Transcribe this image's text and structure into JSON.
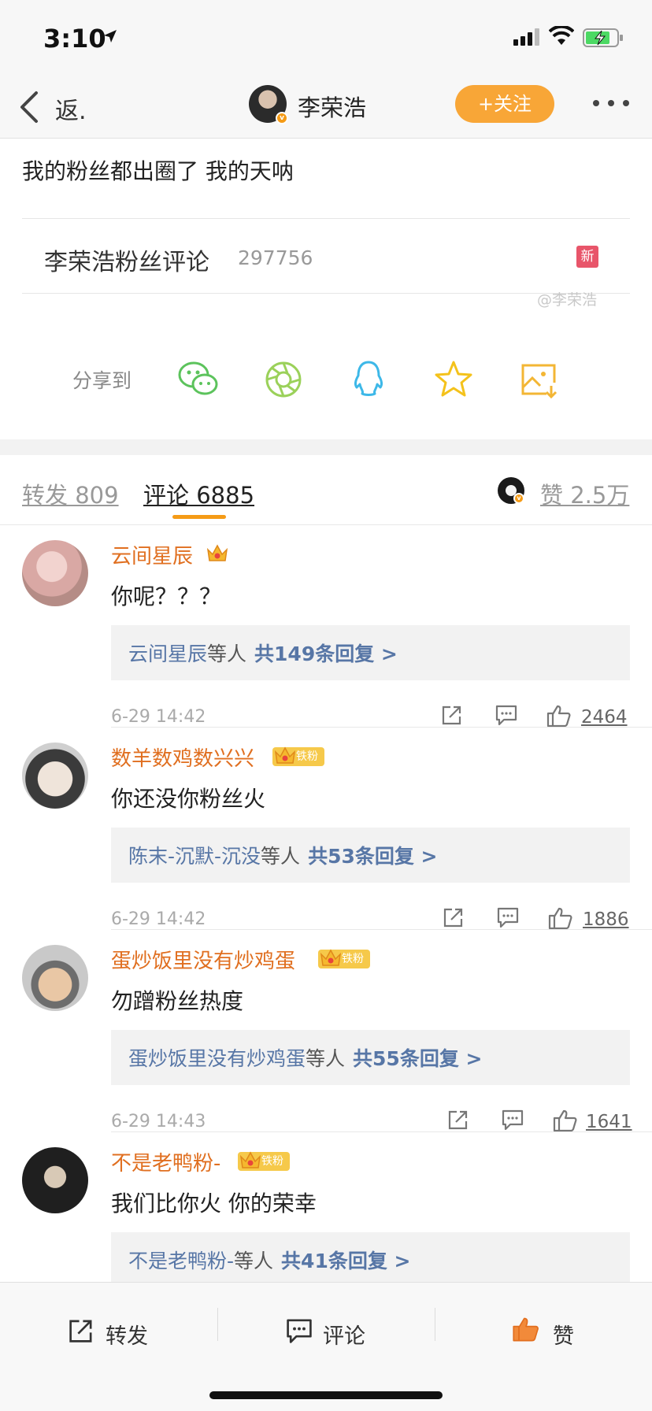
{
  "status_bar": {
    "time": "3:10"
  },
  "nav": {
    "back_label": "返.",
    "account_name": "李荣浩",
    "follow_label": "+关注"
  },
  "post": {
    "text": "我的粉丝都出圈了 我的天呐",
    "topic_title": "李荣浩粉丝评论",
    "topic_count": "297756",
    "new_badge": "新",
    "watermark": "@李荣浩"
  },
  "share": {
    "label": "分享到",
    "icons": [
      "wechat-icon",
      "moments-icon",
      "qq-icon",
      "favorite-star-icon",
      "save-image-icon"
    ]
  },
  "tabs": {
    "repost": "转发 809",
    "comment": "评论 6885",
    "like": "赞 2.5万"
  },
  "comments": [
    {
      "name": "云间星辰",
      "iron_label": "",
      "text": "你呢？？？",
      "reply_users": "云间星辰",
      "reply_etc": "等人",
      "reply_count": "共149条回复 >",
      "time": "6-29 14:42",
      "likes": "2464"
    },
    {
      "name": "数羊数鸡数兴兴",
      "iron_label": "铁粉",
      "text": "你还没你粉丝火",
      "reply_users": "陈末-沉默-沉没",
      "reply_etc": "等人",
      "reply_count": "共53条回复 >",
      "time": "6-29 14:42",
      "likes": "1886"
    },
    {
      "name": "蛋炒饭里没有炒鸡蛋",
      "iron_label": "铁粉",
      "text": "勿蹭粉丝热度",
      "reply_users": "蛋炒饭里没有炒鸡蛋",
      "reply_etc": "等人",
      "reply_count": "共55条回复 >",
      "time": "6-29 14:43",
      "likes": "1641"
    },
    {
      "name": "不是老鸭粉-",
      "iron_label": "铁粉",
      "text": "我们比你火 你的荣幸",
      "reply_users": "不是老鸭粉-",
      "reply_etc": "等人",
      "reply_count": "共41条回复 >",
      "time": "",
      "likes": ""
    }
  ],
  "bottom_bar": {
    "repost": "转发",
    "comment": "评论",
    "like": "赞"
  },
  "colors": {
    "accent_orange": "#f8a637",
    "username_orange": "#e06f20",
    "reply_link_blue": "#5776a6"
  }
}
